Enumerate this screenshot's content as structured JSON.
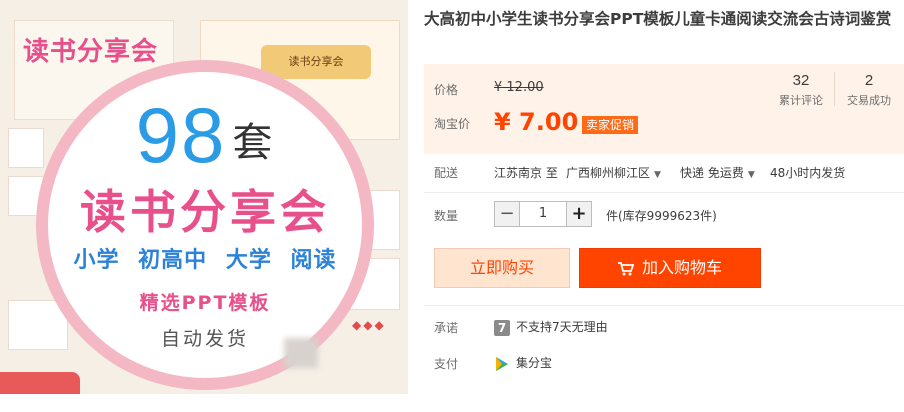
{
  "product_image": {
    "cover_title": "读书分享会",
    "hero_banner": "读书分享会",
    "count_number": "98",
    "count_unit": "套",
    "headline": "读书分享会",
    "categories": [
      "小学",
      "初高中",
      "大学",
      "阅读"
    ],
    "pick_line": "精选PPT模板",
    "auto_line": "自动发货"
  },
  "title": "大高初中小学生读书分享会PPT模板儿童卡通阅读交流会古诗词鉴赏",
  "price": {
    "label": "价格",
    "original": "¥ 12.00",
    "taobao_label": "淘宝价",
    "current": "¥ 7.00",
    "promo_badge": "卖家促销",
    "stats": [
      {
        "number": "32",
        "label": "累计评论"
      },
      {
        "number": "2",
        "label": "交易成功"
      }
    ]
  },
  "delivery": {
    "label": "配送",
    "from": "江苏南京 至",
    "to": "广西柳州柳江区",
    "method": "快递 免运费",
    "ship_time": "48小时内发货"
  },
  "quantity": {
    "label": "数量",
    "value": "1",
    "minus": "−",
    "plus": "+",
    "stock": "件(库存9999623件)"
  },
  "actions": {
    "buy_now": "立即购买",
    "add_to_cart": "加入购物车"
  },
  "promise": {
    "label": "承诺",
    "badge": "7",
    "text": "不支持7天无理由"
  },
  "payment": {
    "label": "支付",
    "method": "集分宝"
  },
  "colors": {
    "accent": "#ff4400",
    "price_bg": "#fff2e8",
    "buy_bg": "#ffe4d0",
    "circle_ring": "#f4b8c4",
    "number_blue": "#2b9be6",
    "headline_pink": "#e8508c"
  }
}
